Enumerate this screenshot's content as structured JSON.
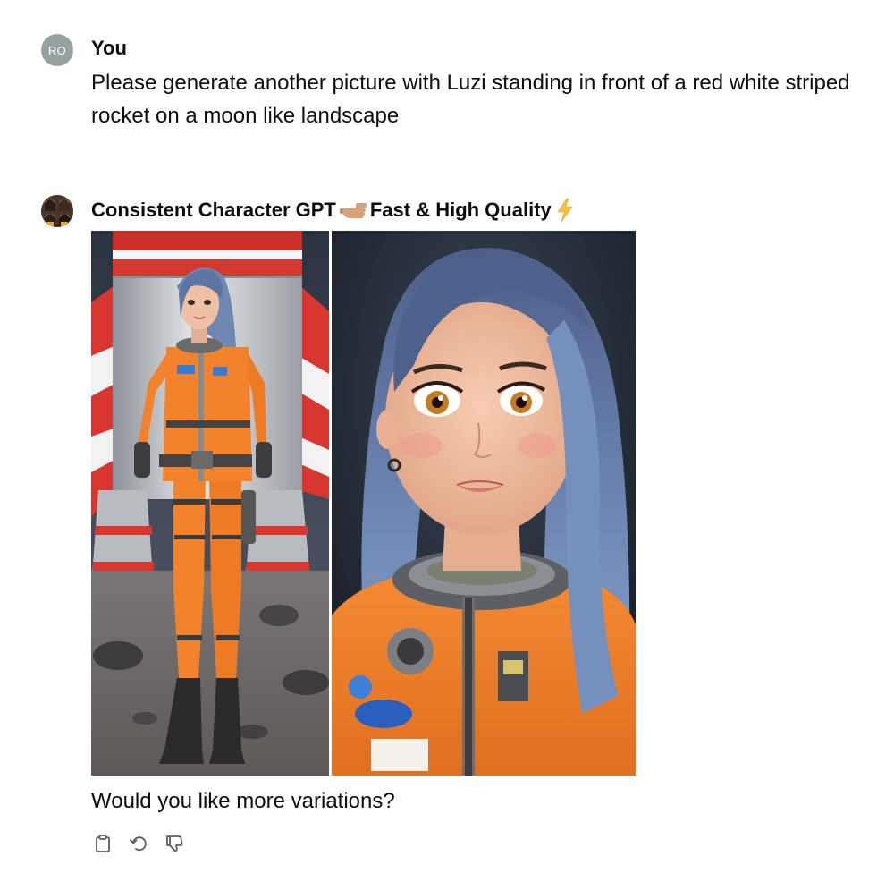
{
  "user_message": {
    "avatar_initials": "RO",
    "author": "You",
    "text": "Please generate another picture with Luzi standing in front of a red white striped rocket on a moon like landscape"
  },
  "assistant_message": {
    "avatar_icon": "gpt-character-avatar",
    "author": "Consistent Character GPT",
    "author_suffix": "Fast & High Quality",
    "author_emoji_1": "pointing-hand-icon",
    "author_emoji_2": "lightning-icon",
    "images": [
      {
        "name": "full-body-image",
        "icon": "astronaut-full-body-illustration"
      },
      {
        "name": "portrait-image",
        "icon": "astronaut-portrait-illustration"
      }
    ],
    "reply_text": "Would you like more variations?",
    "actions": [
      {
        "name": "copy-button",
        "icon": "clipboard-icon"
      },
      {
        "name": "regenerate-button",
        "icon": "refresh-icon"
      },
      {
        "name": "thumbs-down-button",
        "icon": "thumbs-down-icon"
      }
    ]
  },
  "colors": {
    "avatar_user_bg": "#98a0a1",
    "suit_orange": "#f2822c",
    "rocket_red": "#d8372f",
    "hair_blue": "#6f87b3",
    "lightning": "#f5c13a"
  }
}
